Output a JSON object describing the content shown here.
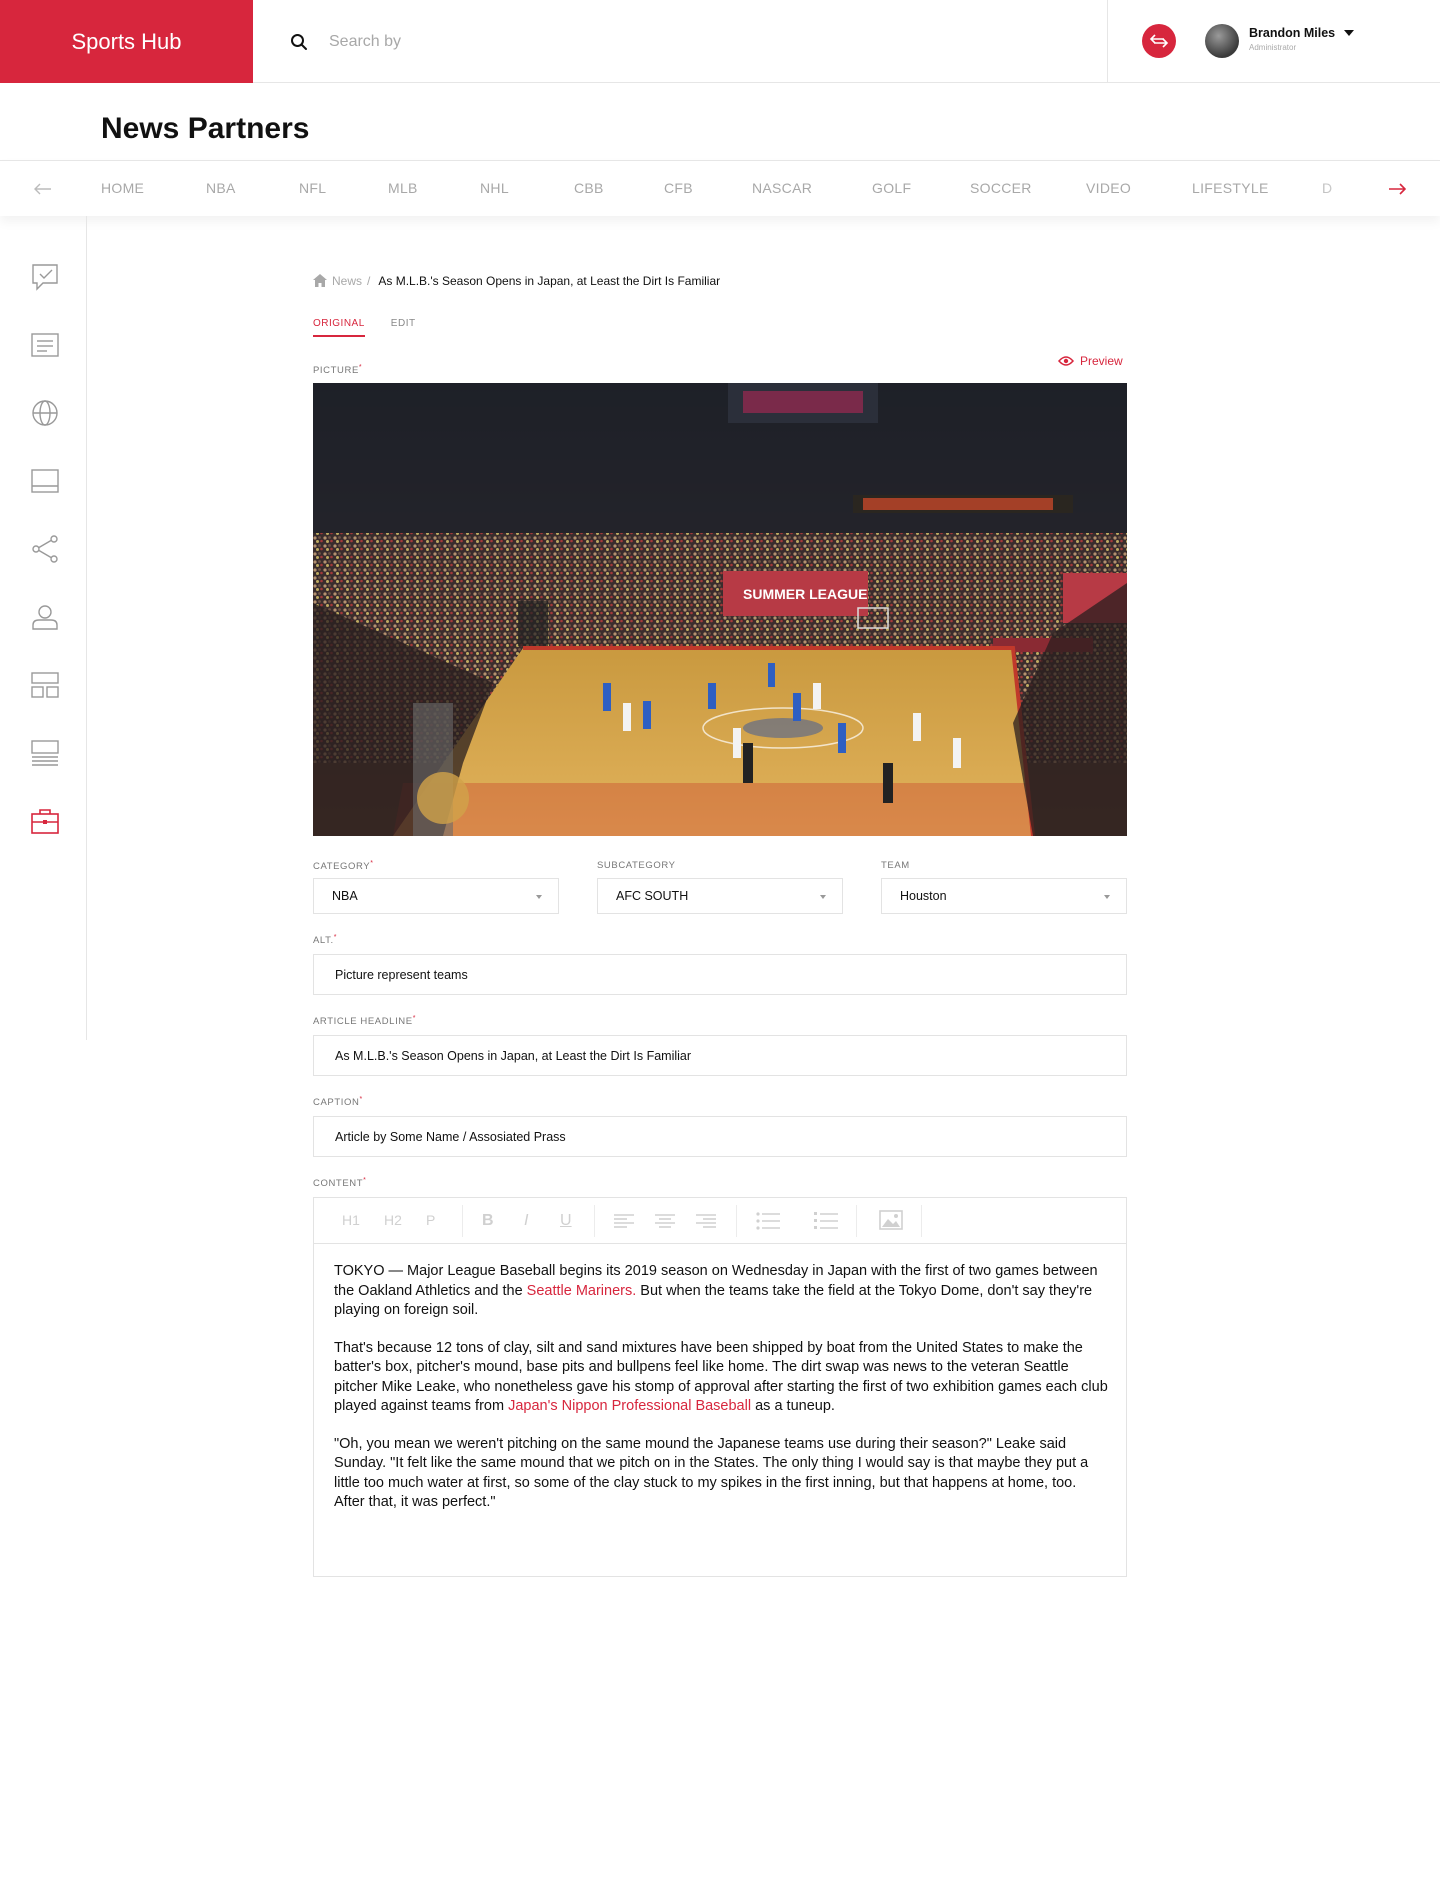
{
  "brand": {
    "name": "Sports Hub",
    "color": "#d7263d"
  },
  "search": {
    "placeholder": "Search by",
    "icon": "search-icon"
  },
  "user": {
    "name": "Brandon Miles",
    "role": "Administrator"
  },
  "page": {
    "title": "News Partners"
  },
  "categories": [
    "HOME",
    "NBA",
    "NFL",
    "MLB",
    "NHL",
    "CBB",
    "CFB",
    "NASCAR",
    "GOLF",
    "SOCCER",
    "VIDEO",
    "LIFESTYLE",
    "D"
  ],
  "sidebar": {
    "items": [
      {
        "icon": "checkbox-comment-icon"
      },
      {
        "icon": "article-icon"
      },
      {
        "icon": "globe-icon"
      },
      {
        "icon": "tablet-icon"
      },
      {
        "icon": "share-icon"
      },
      {
        "icon": "users-icon"
      },
      {
        "icon": "layout-icon"
      },
      {
        "icon": "list-icon"
      },
      {
        "icon": "briefcase-icon",
        "active": true
      }
    ]
  },
  "breadcrumb": {
    "parent": "News",
    "separator": "/",
    "current": "As M.L.B.'s Season Opens in Japan, at Least the Dirt Is Familiar"
  },
  "tabs": {
    "original": "ORIGINAL",
    "edit": "EDIT"
  },
  "form": {
    "picture_label": "PICTURE",
    "preview_label": "Preview",
    "category_label": "CATEGORY",
    "category_value": "NBA",
    "subcategory_label": "SUBCATEGORY",
    "subcategory_value": "AFC SOUTH",
    "team_label": "TEAM",
    "team_value": "Houston",
    "alt_label": "ALT.",
    "alt_value": "Picture represent teams",
    "headline_label": "ARTICLE HEADLINE",
    "headline_value": "As M.L.B.'s Season Opens in Japan, at Least the Dirt Is Familiar",
    "caption_label": "CAPTION",
    "caption_value": "Article by Some Name / Assosiated Prass",
    "content_label": "CONTENT",
    "required_mark": "*"
  },
  "picture": {
    "banner_text": "SUMMER LEAGUE"
  },
  "toolbar": {
    "h1": "H1",
    "h2": "H2",
    "p": "P",
    "bold": "B",
    "italic": "I",
    "underline": "U"
  },
  "content": {
    "p1_a": "TOKYO — Major League Baseball begins its 2019 season on Wednesday in Japan with the first of two games between the Oakland Athletics and the ",
    "p1_link": "Seattle Mariners.",
    "p1_b": " But when the teams take the field at the Tokyo Dome, don't say they're playing on foreign soil.",
    "p2_a": "That's because 12 tons of clay, silt and sand mixtures have been shipped by boat from the United States to make the batter's box, pitcher's mound, base pits and bullpens feel like home. The dirt swap was news to the veteran Seattle pitcher Mike Leake, who nonetheless gave his stomp of approval after starting the first of two exhibition games each club played against teams from ",
    "p2_link": "Japan's Nippon Professional Baseball",
    "p2_b": " as a tuneup.",
    "p3": "\"Oh, you mean we weren't pitching on the same mound the Japanese teams use during their season?\" Leake said Sunday. \"It felt like the same mound that we pitch on in the States. The only thing I would say is that maybe they put a little too much water at first, so some of the clay stuck to my spikes in the first inning, but that happens at home, too. After that, it was perfect.\""
  }
}
